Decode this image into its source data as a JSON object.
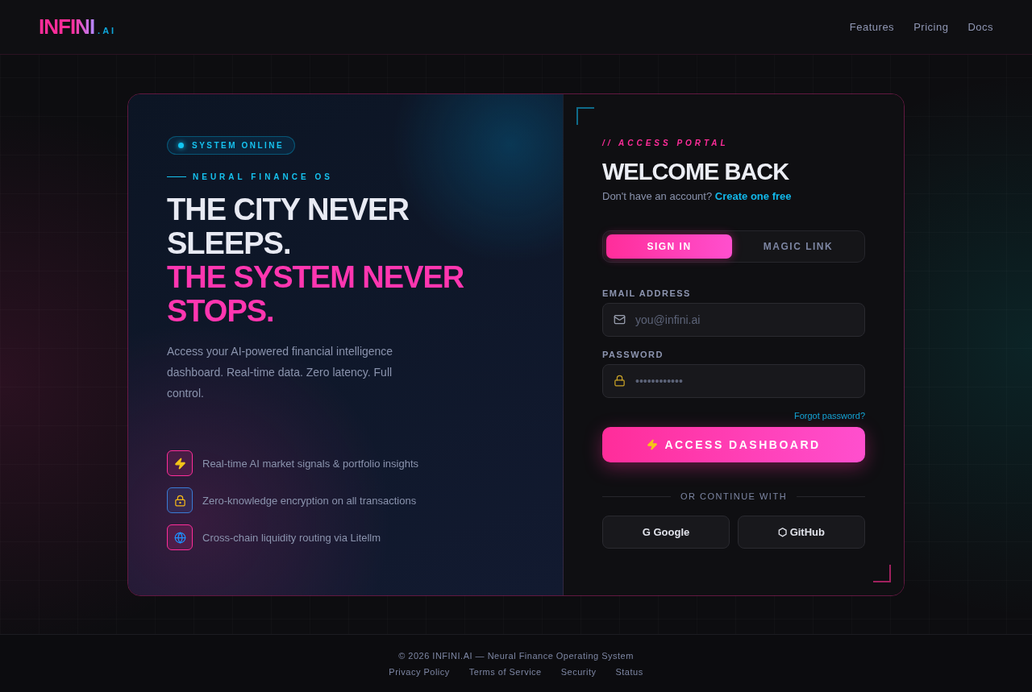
{
  "header": {
    "logo": "INFINI",
    "logo_suffix": ".AI",
    "nav": [
      "Features",
      "Pricing",
      "Docs"
    ]
  },
  "hero": {
    "status": {
      "label": "SYSTEM ONLINE",
      "on": true
    },
    "eyebrow": "NEURAL FINANCE OS",
    "headline_1": "THE CITY NEVER SLEEPS.",
    "headline_2": "THE SYSTEM NEVER STOPS.",
    "description": "Access your AI-powered financial intelligence dashboard. Real-time data. Zero latency. Full control.",
    "features": [
      {
        "kind": "bolt",
        "text": "Real-time AI market signals & portfolio insights",
        "color": "#ff2d9a"
      },
      {
        "kind": "lock",
        "text": "Zero-knowledge encryption on all transactions",
        "color": "#3a7bd5"
      },
      {
        "kind": "globe",
        "text": "Cross-chain liquidity routing via Litellm",
        "color": "#ff2d9a"
      }
    ]
  },
  "login": {
    "eyebrow": "// ACCESS PORTAL",
    "title": "WELCOME BACK",
    "prompt": "Don't have an account?",
    "signup_link": "Create one free",
    "tabs": [
      {
        "label": "SIGN IN",
        "selected": true
      },
      {
        "label": "MAGIC LINK",
        "selected": false
      }
    ],
    "fields": [
      {
        "kind": "email",
        "label": "EMAIL ADDRESS",
        "placeholder": "you@infini.ai"
      },
      {
        "kind": "password",
        "label": "PASSWORD",
        "placeholder": "••••••••••••"
      }
    ],
    "forgot": "Forgot password?",
    "submit": "ACCESS DASHBOARD",
    "divider": "OR CONTINUE WITH",
    "providers": [
      {
        "glyph": "G",
        "label": "Google"
      },
      {
        "glyph": "⬡",
        "label": "GitHub"
      }
    ]
  },
  "footer": {
    "copyright": "© 2026 INFINI.AI — Neural Finance Operating System",
    "links": [
      "Privacy Policy",
      "Terms of Service",
      "Security",
      "Status"
    ]
  }
}
